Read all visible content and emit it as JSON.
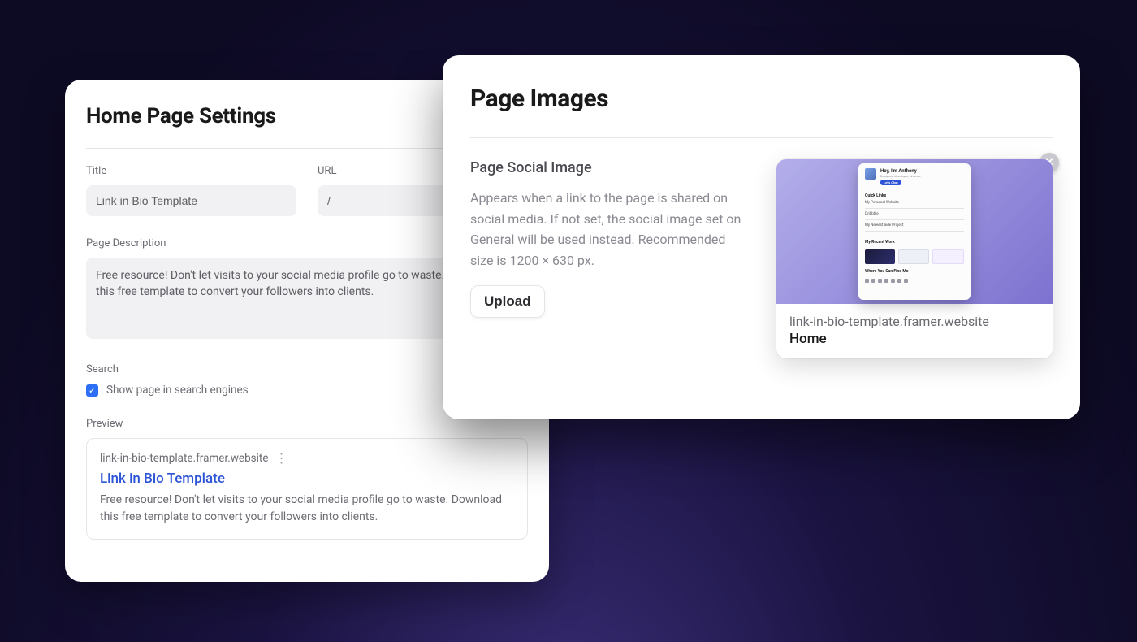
{
  "home": {
    "heading": "Home Page Settings",
    "title_label": "Title",
    "title_value": "Link in Bio Template",
    "url_label": "URL",
    "url_value": "/",
    "desc_label": "Page Description",
    "desc_value": "Free resource! Don't let visits to your social media profile go to waste. Download this free template to convert your followers into clients.",
    "search_label": "Search",
    "search_checkbox_checked": true,
    "search_checkbox_label": "Show page in search engines",
    "preview_label": "Preview",
    "preview": {
      "url": "link-in-bio-template.framer.website",
      "title": "Link in Bio Template",
      "desc": "Free resource! Don't let visits to your social media profile go to waste. Download this free template to convert your followers into clients."
    }
  },
  "images": {
    "heading": "Page Images",
    "subheading": "Page Social Image",
    "help": "Appears when a link to the page is shared on social media. If not set, the social image set on General will be used instead. Recommended size is 1200 × 630 px.",
    "upload_label": "Upload",
    "card": {
      "url": "link-in-bio-template.framer.website",
      "title": "Home"
    },
    "thumb": {
      "hey": "Hey, I'm Anthony",
      "chip": "Let's Chat",
      "quick_links_label": "Quick Links",
      "links": [
        "My Personal Website",
        "Dribbble",
        "My Newest Side Project"
      ],
      "recent_label": "My Recent Work",
      "find_label": "Where You Can Find Me"
    }
  }
}
